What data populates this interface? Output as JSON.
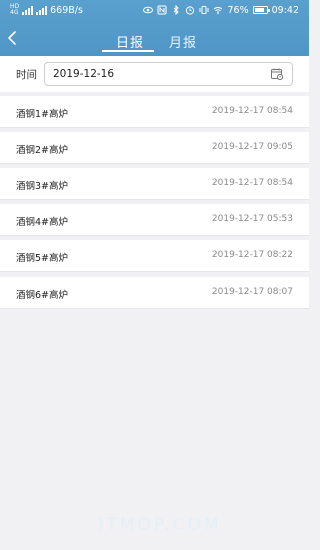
{
  "status_bar": {
    "net_top": "HD",
    "net_bottom": "4G",
    "speed": "669B/s",
    "battery_pct": "76%",
    "time": "09:42",
    "icons": [
      "eye-icon",
      "nfc-icon",
      "bluetooth-icon",
      "alarm-icon",
      "vibrate-icon",
      "wifi-icon"
    ]
  },
  "header": {
    "tabs": [
      {
        "label": "日报",
        "active": true
      },
      {
        "label": "月报",
        "active": false
      }
    ]
  },
  "filter": {
    "label": "时间",
    "date": "2019-12-16"
  },
  "records": [
    {
      "name": "酒钢1#高炉",
      "time": "2019-12-17 08:54"
    },
    {
      "name": "酒钢2#高炉",
      "time": "2019-12-17 09:05"
    },
    {
      "name": "酒钢3#高炉",
      "time": "2019-12-17 08:54"
    },
    {
      "name": "酒钢4#高炉",
      "time": "2019-12-17 05:53"
    },
    {
      "name": "酒钢5#高炉",
      "time": "2019-12-17 08:22"
    },
    {
      "name": "酒钢6#高炉",
      "time": "2019-12-17 08:07"
    }
  ],
  "watermark": "ITMOP.COM",
  "colors": {
    "header": "#5a9fcd",
    "background": "#f1f1f3"
  }
}
